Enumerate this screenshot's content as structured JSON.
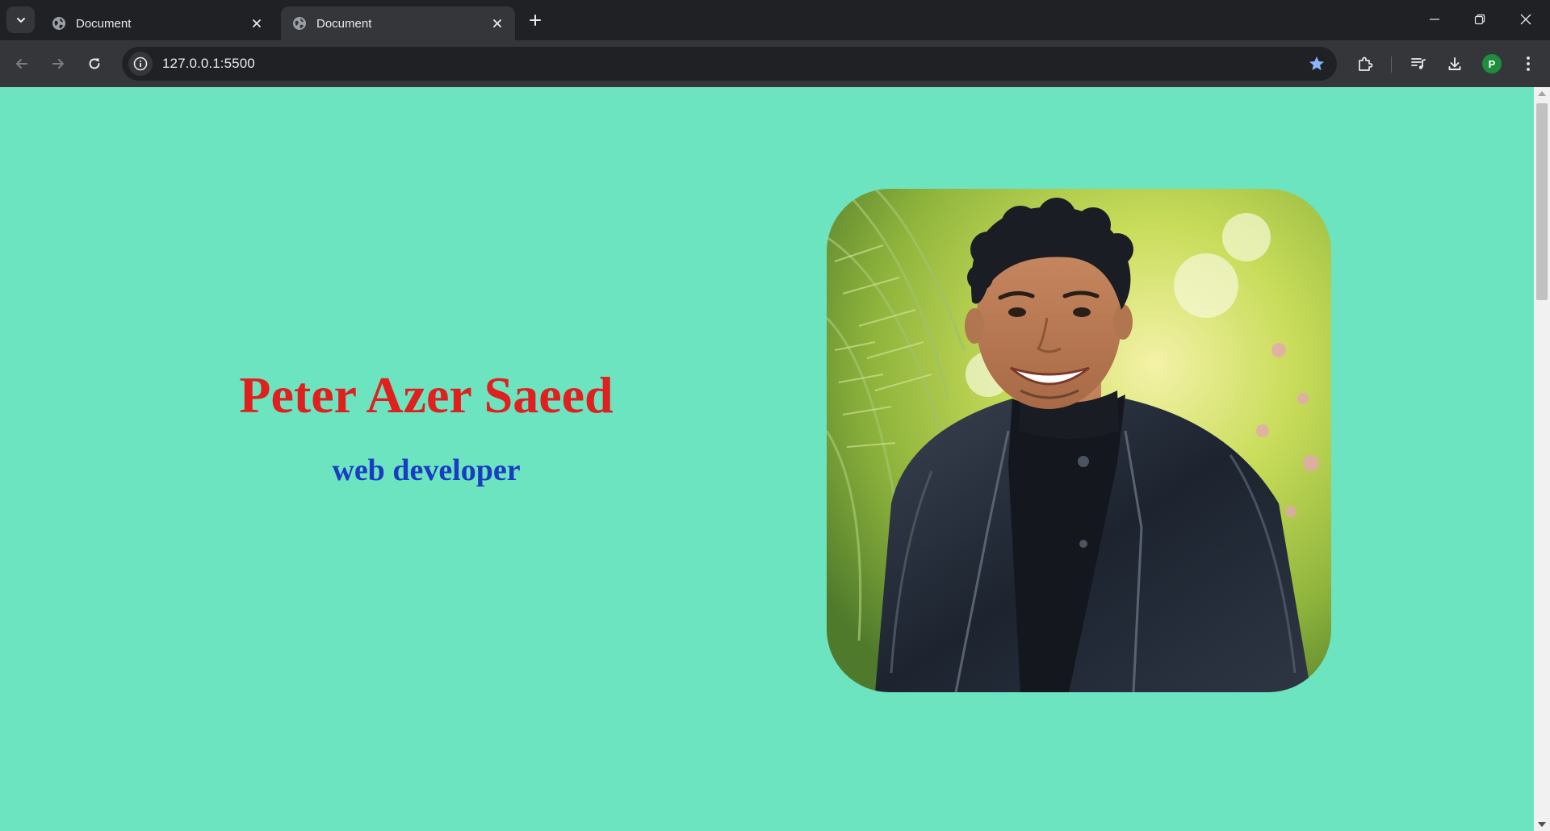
{
  "browser": {
    "tabs": [
      {
        "title": "Document",
        "active": false
      },
      {
        "title": "Document",
        "active": true
      }
    ],
    "address_bar": {
      "url": "127.0.0.1:5500"
    },
    "profile_initial": "P",
    "colors": {
      "frame": "#202124",
      "toolbar": "#35363a",
      "text": "#e8eaed",
      "star": "#8ab4f8",
      "avatar": "#1e8e3e"
    }
  },
  "page": {
    "background": "#6ce4bf",
    "name": "Peter Azer Saeed",
    "name_color": "#e0201f",
    "role": "web developer",
    "role_color": "#1a3cc0",
    "photo": "portrait of a smiling young man with dark curly hair wearing a black leather jacket, green foliage background"
  }
}
